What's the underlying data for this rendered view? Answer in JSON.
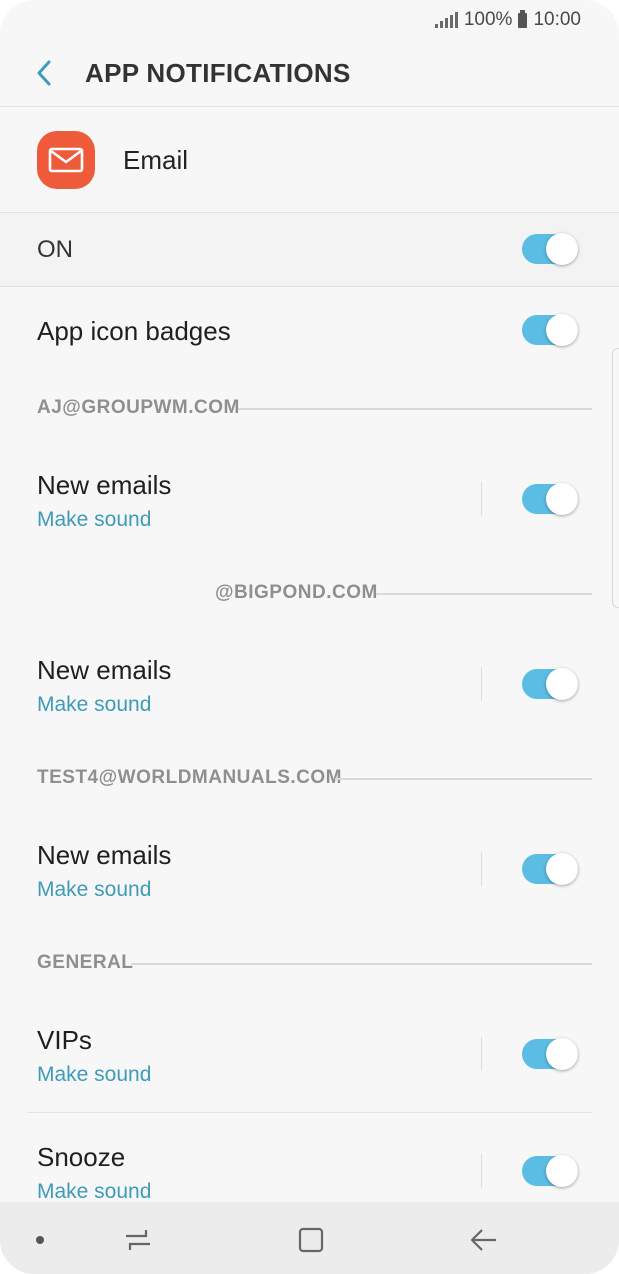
{
  "status_bar": {
    "battery_text": "100%",
    "time": "10:00"
  },
  "header": {
    "title": "APP NOTIFICATIONS"
  },
  "app": {
    "name": "Email",
    "icon": "envelope-icon",
    "icon_color": "#ef5b3a"
  },
  "master": {
    "label": "ON",
    "on": true
  },
  "badges": {
    "label": "App icon badges",
    "on": true
  },
  "sections": [
    {
      "label": "AJ@GROUPWM.COM",
      "item": {
        "title": "New emails",
        "subtitle": "Make sound",
        "on": true
      }
    },
    {
      "label": "@BIGPOND.COM",
      "item": {
        "title": "New emails",
        "subtitle": "Make sound",
        "on": true
      }
    },
    {
      "label": "TEST4@WORLDMANUALS.COM",
      "item": {
        "title": "New emails",
        "subtitle": "Make sound",
        "on": true
      }
    }
  ],
  "general": {
    "label": "GENERAL",
    "items": [
      {
        "title": "VIPs",
        "subtitle": "Make sound",
        "on": true
      },
      {
        "title": "Snooze",
        "subtitle": "Make sound",
        "on": true
      }
    ]
  },
  "colors": {
    "accent": "#5bbde3",
    "subtitle": "#3e9bb9",
    "section_label": "#8f8f8f"
  },
  "nav": {
    "recent_icon": "recent-apps-icon",
    "home_icon": "home-icon",
    "back_icon": "back-arrow-icon"
  }
}
